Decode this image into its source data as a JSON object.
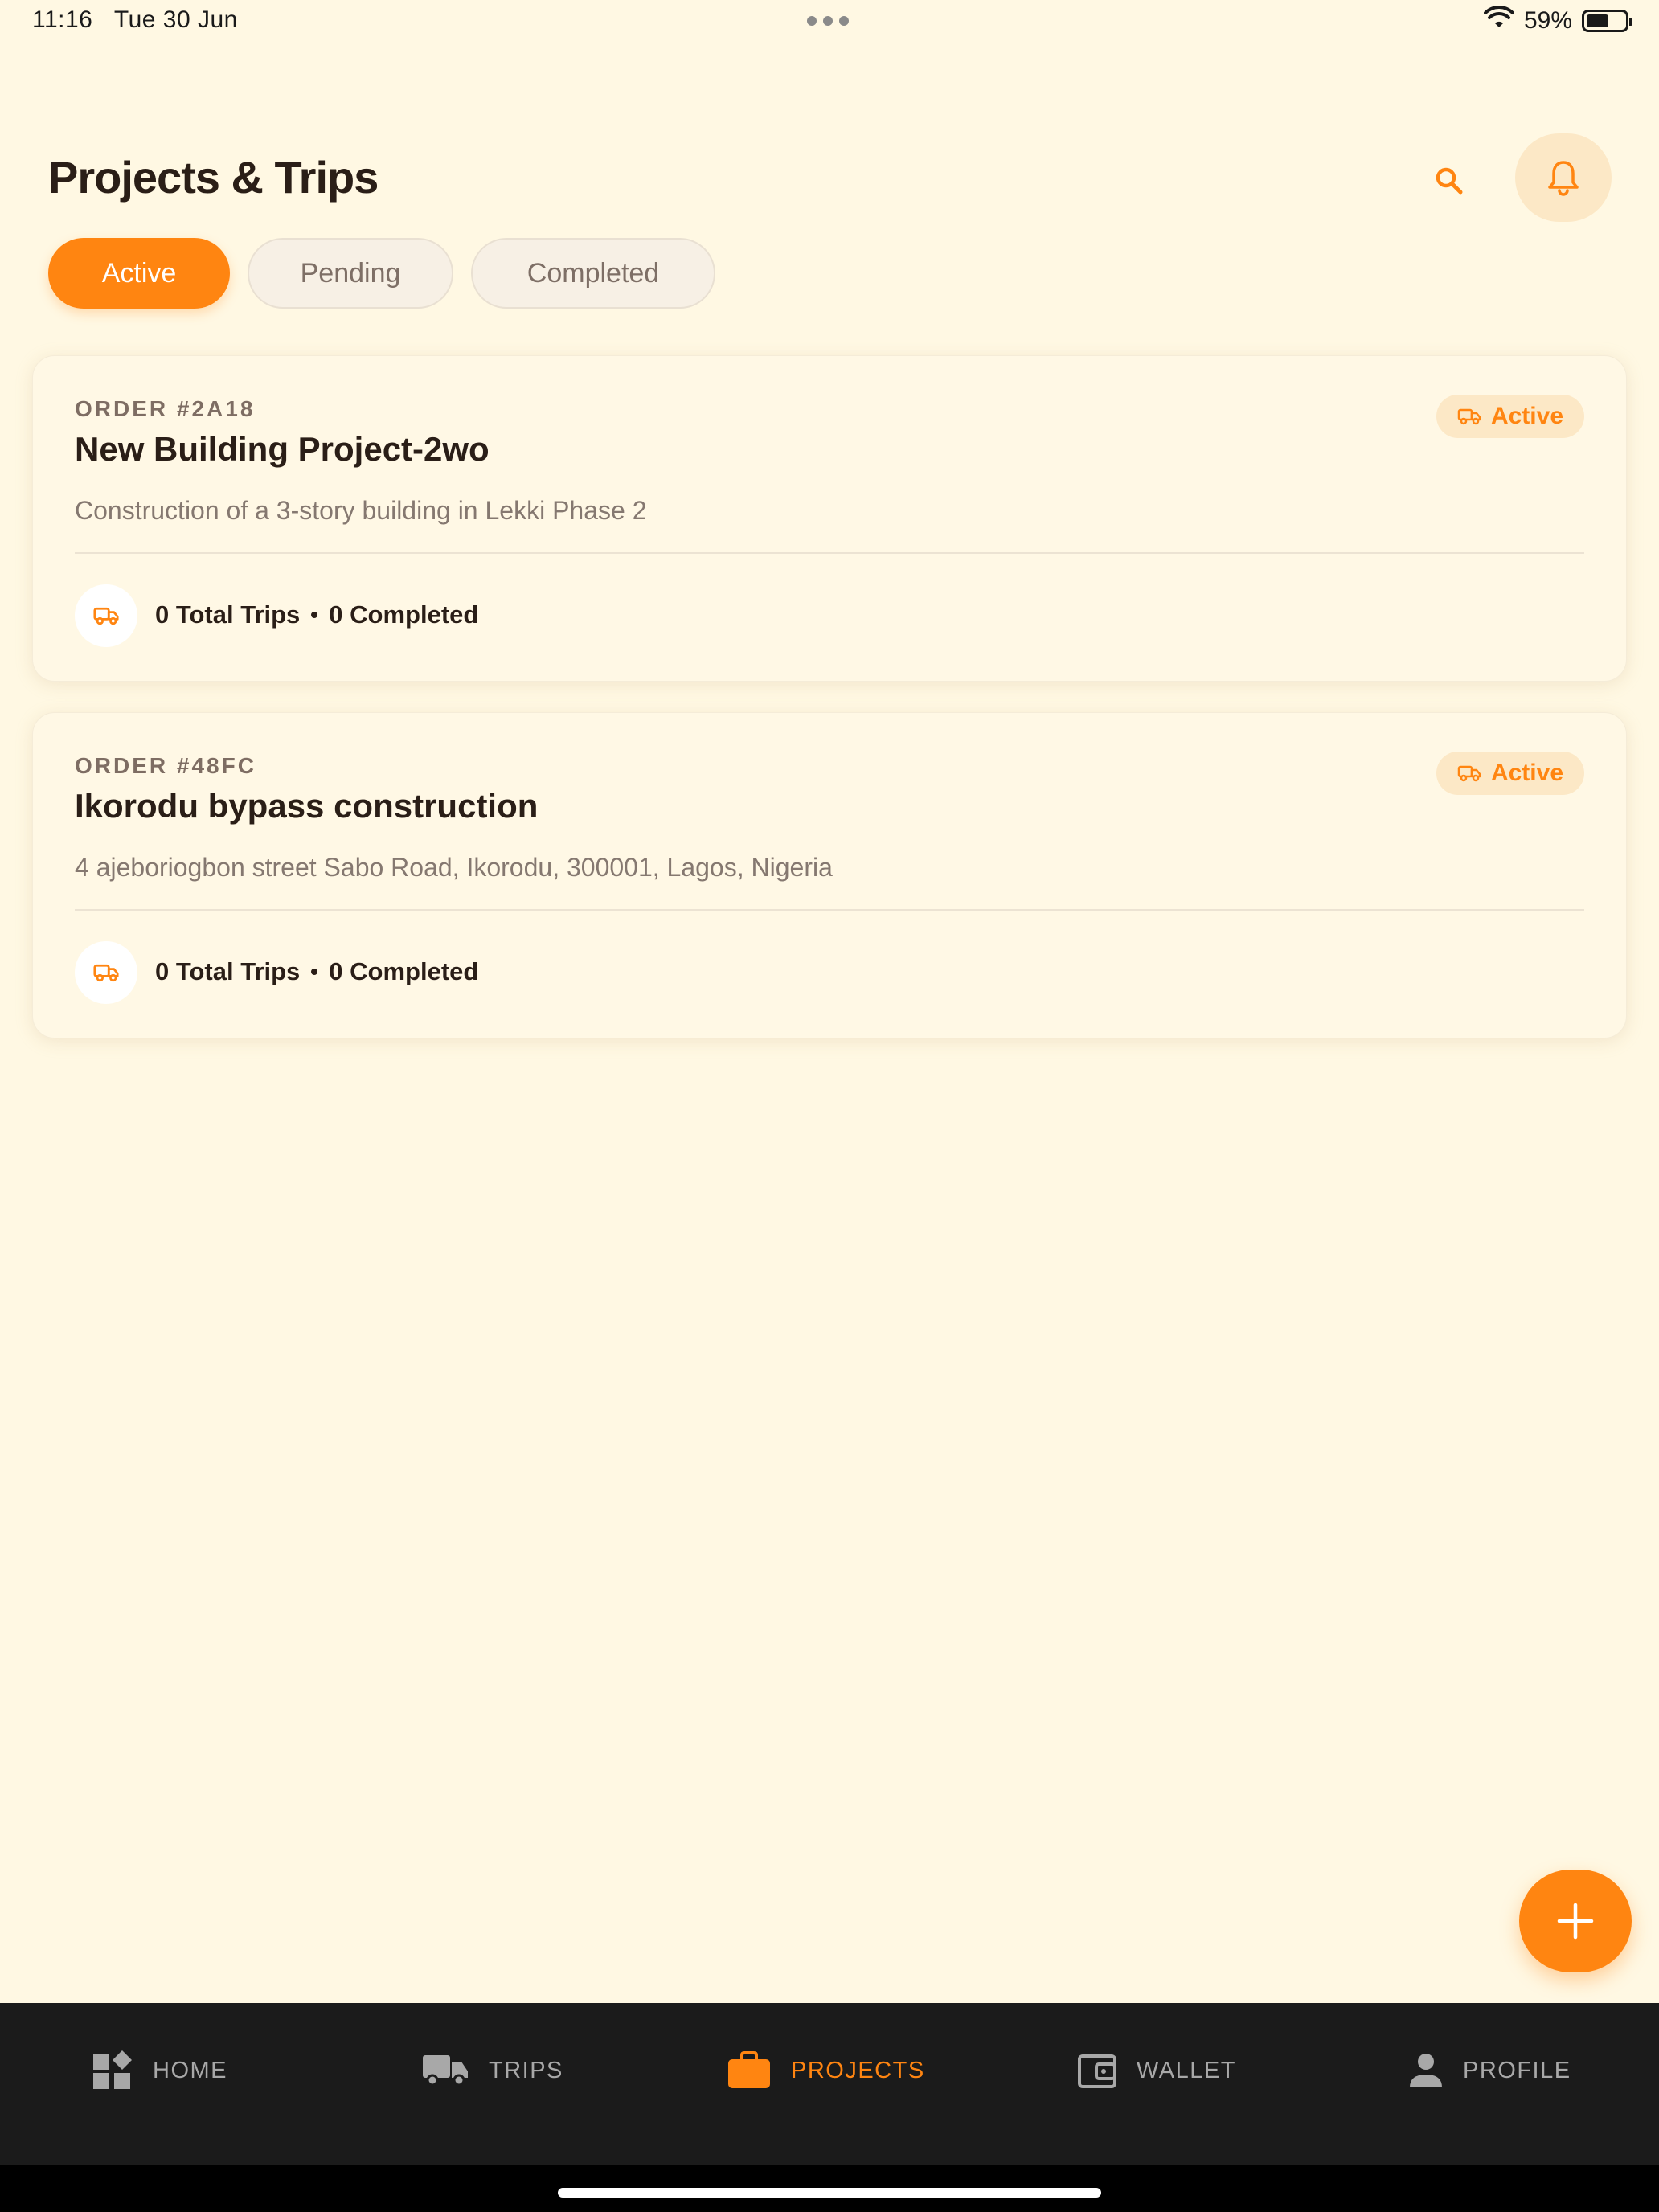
{
  "status_bar": {
    "time": "11:16",
    "date": "Tue 30 Jun",
    "battery": "59%",
    "battery_level": 0.59
  },
  "header": {
    "title": "Projects & Trips",
    "search_icon": "search-icon",
    "notification_icon": "bell-icon"
  },
  "tabs": [
    {
      "label": "Active",
      "selected": true
    },
    {
      "label": "Pending",
      "selected": false
    },
    {
      "label": "Completed",
      "selected": false
    }
  ],
  "projects": [
    {
      "order": "ORDER #2A18",
      "title": "New Building Project-2wo",
      "description": "Construction of a 3-story building in Lekki Phase 2",
      "status": "Active",
      "total_trips": "0 Total Trips",
      "completed": "0 Completed"
    },
    {
      "order": "ORDER #48FC",
      "title": "Ikorodu bypass construction",
      "description": "4 ajeboriogbon street Sabo Road, Ikorodu, 300001, Lagos, Nigeria",
      "status": "Active",
      "total_trips": "0 Total Trips",
      "completed": "0 Completed"
    }
  ],
  "fab": {
    "icon": "plus-icon"
  },
  "nav": [
    {
      "label": "HOME",
      "icon": "home-icon",
      "active": false
    },
    {
      "label": "TRIPS",
      "icon": "truck-icon",
      "active": false
    },
    {
      "label": "PROJECTS",
      "icon": "briefcase-icon",
      "active": true
    },
    {
      "label": "WALLET",
      "icon": "wallet-icon",
      "active": false
    },
    {
      "label": "PROFILE",
      "icon": "person-icon",
      "active": false
    }
  ],
  "colors": {
    "accent": "#FF8511",
    "background": "#FFF8E3",
    "nav_background": "#1B1B1B",
    "badge_background": "#FCE8C6"
  }
}
